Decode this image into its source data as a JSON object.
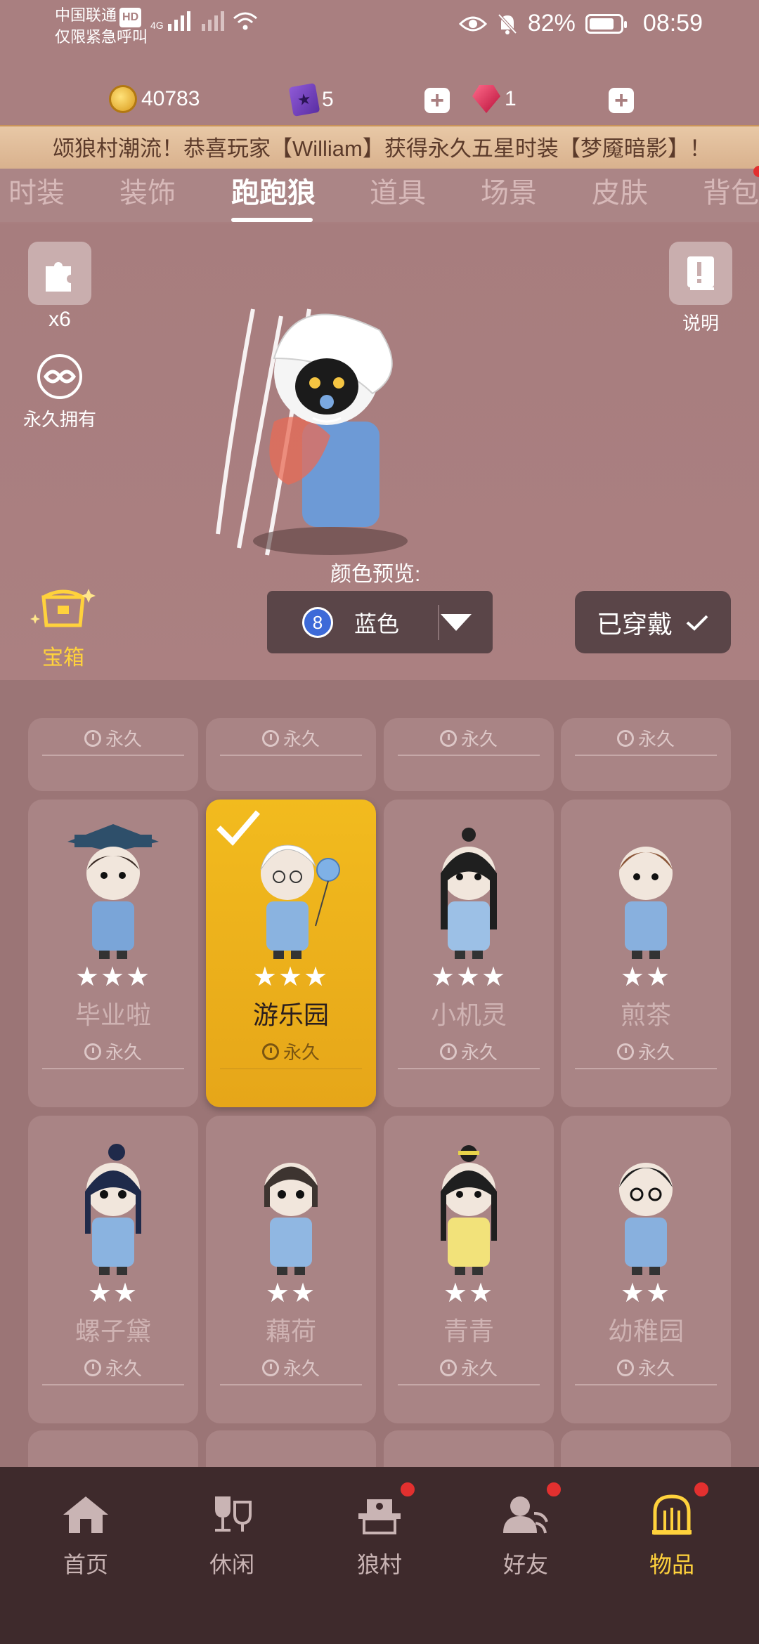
{
  "status_bar": {
    "carrier": "中国联通",
    "hd": "HD",
    "network": "4G",
    "emergency": "仅限紧急呼叫",
    "battery_pct": "82%",
    "battery_level": 0.82,
    "time": "08:59"
  },
  "currency": {
    "coins": "40783",
    "books": "5",
    "gems": "1"
  },
  "marquee": "颂狼村潮流！恭喜玩家【William】获得永久五星时装【梦魇暗影】！",
  "tabs": [
    "时装",
    "装饰",
    "跑跑狼",
    "道具",
    "场景",
    "皮肤",
    "背包"
  ],
  "active_tab": "跑跑狼",
  "character": {
    "puzzle_count": "x6",
    "ownership": "永久拥有",
    "help_label": "说明",
    "color_preview_label": "颜色预览:",
    "color_index": "8",
    "color_name": "蓝色",
    "wear_label": "已穿戴",
    "chest_label": "宝箱"
  },
  "grid": {
    "top_row_duration": "永久",
    "items": [
      {
        "name": "毕业啦",
        "stars": "★★★",
        "duration": "永久",
        "selected": false
      },
      {
        "name": "游乐园",
        "stars": "★★★",
        "duration": "永久",
        "selected": true
      },
      {
        "name": "小机灵",
        "stars": "★★★",
        "duration": "永久",
        "selected": false
      },
      {
        "name": "煎茶",
        "stars": "★★",
        "duration": "永久",
        "selected": false
      },
      {
        "name": "螺子黛",
        "stars": "★★",
        "duration": "永久",
        "selected": false
      },
      {
        "name": "藕荷",
        "stars": "★★",
        "duration": "永久",
        "selected": false
      },
      {
        "name": "青青",
        "stars": "★★",
        "duration": "永久",
        "selected": false
      },
      {
        "name": "幼稚园",
        "stars": "★★",
        "duration": "永久",
        "selected": false
      }
    ]
  },
  "bottom_nav": [
    {
      "label": "首页",
      "icon": "home-icon"
    },
    {
      "label": "休闲",
      "icon": "leisure-icon"
    },
    {
      "label": "狼村",
      "icon": "village-icon"
    },
    {
      "label": "好友",
      "icon": "friends-icon"
    },
    {
      "label": "物品",
      "icon": "items-icon"
    }
  ],
  "colors": {
    "background": "#a97f80",
    "selected_card": "#f2bb1e",
    "accent_gold": "#ffd23c",
    "badge_red": "#e2302f",
    "nav_bg": "#3e2a2c"
  }
}
